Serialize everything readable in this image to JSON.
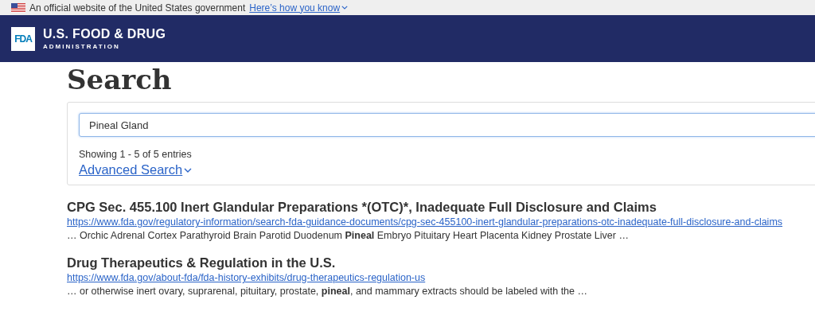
{
  "gov_banner": {
    "text": "An official website of the United States government",
    "link": "Here’s how you know"
  },
  "header": {
    "logo": "FDA",
    "title": "U.S. FOOD & DRUG",
    "subtitle": "ADMINISTRATION"
  },
  "page_title": "Search",
  "search": {
    "value": "Pineal Gland",
    "count": "Showing 1 - 5 of 5 entries",
    "advanced": "Advanced Search"
  },
  "results": [
    {
      "title": "CPG Sec. 455.100 Inert Glandular Preparations *(OTC)*, Inadequate Full Disclosure and Claims",
      "url": "https://www.fda.gov/regulatory-information/search-fda-guidance-documents/cpg-sec-455100-inert-glandular-preparations-otc-inadequate-full-disclosure-and-claims",
      "snippet": "… Orchic Adrenal Cortex Parathyroid Brain Parotid Duodenum **Pineal** Embryo Pituitary Heart Placenta Kidney Prostate Liver …"
    },
    {
      "title": "Drug Therapeutics & Regulation in the U.S.",
      "url": "https://www.fda.gov/about-fda/fda-history-exhibits/drug-therapeutics-regulation-us",
      "snippet": "… or otherwise inert ovary, suprarenal, pituitary, prostate, **pineal**, and mammary extracts should be labeled with the …"
    }
  ]
}
